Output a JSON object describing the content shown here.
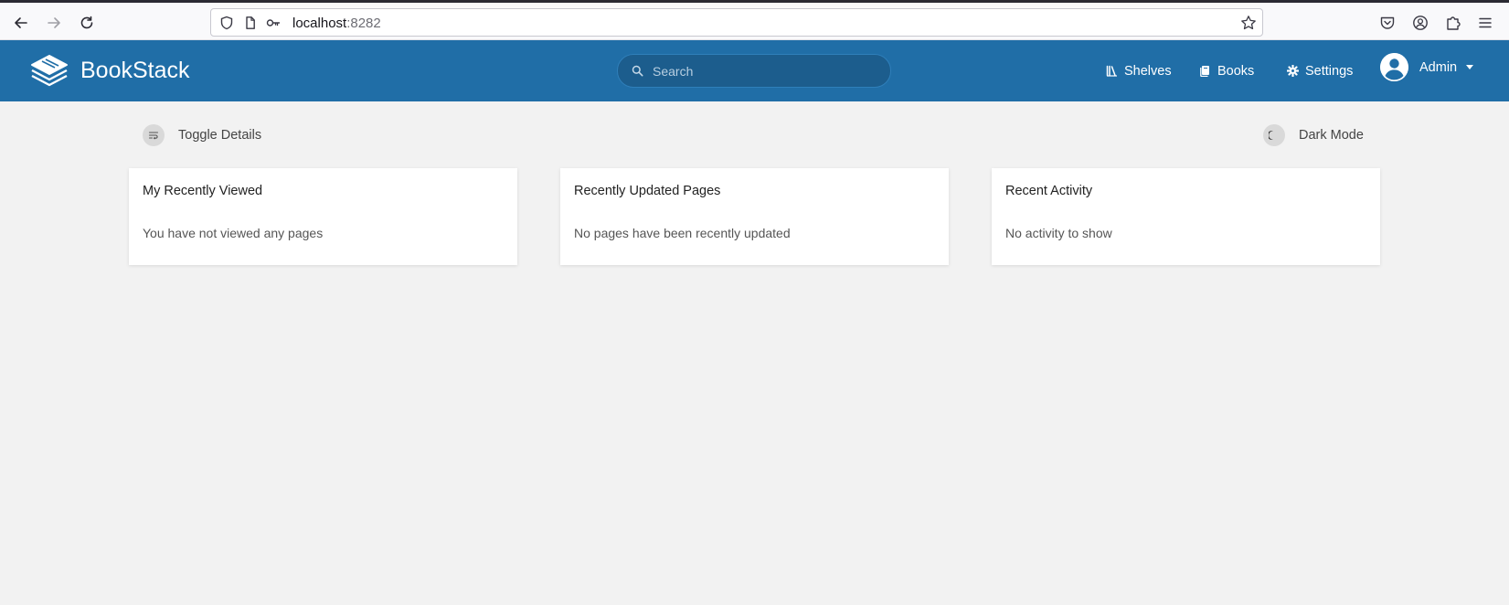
{
  "browser": {
    "url_host": "localhost",
    "url_port": ":8282"
  },
  "header": {
    "app_name": "BookStack",
    "search_placeholder": "Search",
    "nav": {
      "shelves": "Shelves",
      "books": "Books",
      "settings": "Settings"
    },
    "user_name": "Admin",
    "brand_color": "#206ea7"
  },
  "actions": {
    "toggle_details": "Toggle Details",
    "dark_mode": "Dark Mode"
  },
  "cards": [
    {
      "title": "My Recently Viewed",
      "body": "You have not viewed any pages"
    },
    {
      "title": "Recently Updated Pages",
      "body": "No pages have been recently updated"
    },
    {
      "title": "Recent Activity",
      "body": "No activity to show"
    }
  ]
}
